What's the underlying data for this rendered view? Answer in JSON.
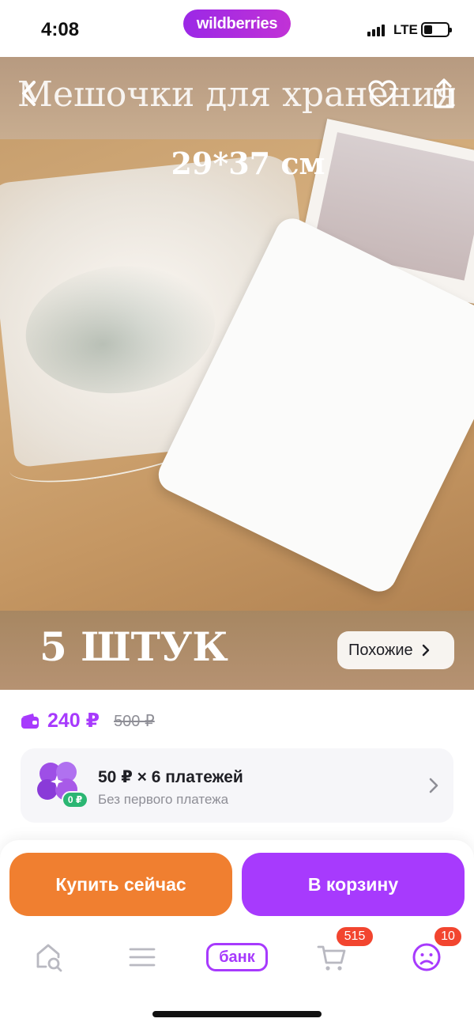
{
  "status_bar": {
    "time": "4:08",
    "brand_logo": "wildberries",
    "network": "LTE",
    "battery_level": 0.35
  },
  "product_image": {
    "overlay_title": "Мешочки для хранения",
    "overlay_size": "29*37 см",
    "overlay_quantity": "5 ШТУК",
    "similar_button_label": "Похожие",
    "icons": [
      "chevron-left-icon",
      "heart-icon",
      "share-icon",
      "chevron-right-icon"
    ]
  },
  "price": {
    "wallet_icon": "wallet-icon",
    "current": "240 ₽",
    "old": "500 ₽",
    "accent_color": "#a73afd"
  },
  "installment": {
    "title": "50 ₽ × 6 платежей",
    "subtitle": "Без первого платежа",
    "badge": "0 ₽",
    "icon": "installment-clover-icon"
  },
  "actions": {
    "buy_now_label": "Купить сейчас",
    "buy_now_color": "#f07f30",
    "add_to_cart_label": "В корзину",
    "add_to_cart_color": "#a73afd"
  },
  "tab_bar": {
    "home_icon": "home-search-icon",
    "catalog_icon": "menu-icon",
    "bank_label": "банк",
    "cart_icon": "cart-icon",
    "cart_badge": "515",
    "profile_icon": "profile-icon",
    "profile_badge": "10",
    "badge_color": "#f2452f"
  }
}
